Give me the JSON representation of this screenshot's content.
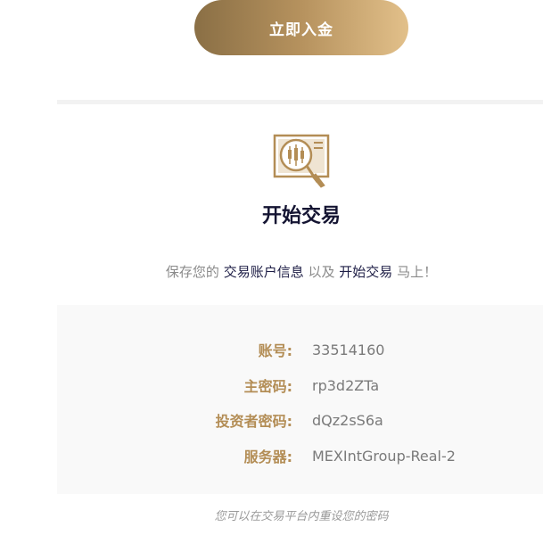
{
  "deposit_button": {
    "label": "立即入金"
  },
  "start_trading": {
    "icon": "chart-magnifier-icon",
    "title": "开始交易",
    "subtitle": {
      "part1": "保存您的",
      "highlight1": "交易账户信息",
      "part2": "以及",
      "highlight2": "开始交易",
      "part3": "马上！"
    }
  },
  "account_info": {
    "rows": [
      {
        "label": "账号:",
        "value": "33514160"
      },
      {
        "label": "主密码:",
        "value": "rp3d2ZTa"
      },
      {
        "label": "投资者密码:",
        "value": "dQz2sS6a"
      },
      {
        "label": "服务器:",
        "value": "MEXIntGroup-Real-2"
      }
    ]
  },
  "footnote": "您可以在交易平台内重设您的密码",
  "colors": {
    "gold": "#b38d55",
    "navy": "#141432",
    "muted": "#8a8a8a"
  }
}
